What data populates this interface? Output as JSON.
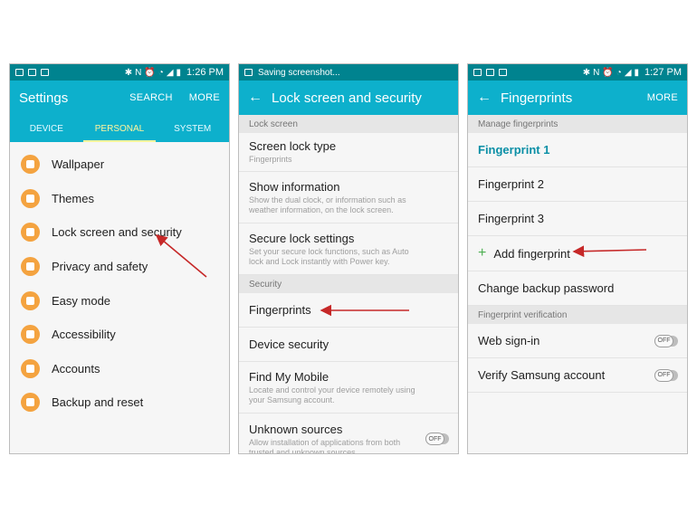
{
  "colors": {
    "status_bar": "#00838f",
    "app_bar": "#0db0cc",
    "icon_bg": "#f4a340",
    "accent": "#0a8fa6",
    "arrow": "#c62828",
    "tab_active": "#fff59d"
  },
  "screen1": {
    "time": "1:26 PM",
    "title": "Settings",
    "actions": [
      "SEARCH",
      "MORE"
    ],
    "tabs": [
      "DEVICE",
      "PERSONAL",
      "SYSTEM"
    ],
    "active_tab": "PERSONAL",
    "items": [
      {
        "label": "Wallpaper",
        "icon": "wallpaper-icon"
      },
      {
        "label": "Themes",
        "icon": "themes-icon"
      },
      {
        "label": "Lock screen and security",
        "icon": "lock-icon"
      },
      {
        "label": "Privacy and safety",
        "icon": "privacy-icon"
      },
      {
        "label": "Easy mode",
        "icon": "home-icon"
      },
      {
        "label": "Accessibility",
        "icon": "hand-icon"
      },
      {
        "label": "Accounts",
        "icon": "key-icon"
      },
      {
        "label": "Backup and reset",
        "icon": "backup-icon"
      }
    ]
  },
  "screen2": {
    "status_text": "Saving screenshot...",
    "title": "Lock screen and security",
    "section_lock": "Lock screen",
    "screen_lock_type": {
      "title": "Screen lock type",
      "sub": "Fingerprints"
    },
    "show_information": {
      "title": "Show information",
      "sub": "Show the dual clock, or information such as weather information, on the lock screen."
    },
    "secure_lock": {
      "title": "Secure lock settings",
      "sub": "Set your secure lock functions, such as Auto lock and Lock instantly with Power key."
    },
    "section_security": "Security",
    "fingerprints": "Fingerprints",
    "device_security": "Device security",
    "find_my_mobile": {
      "title": "Find My Mobile",
      "sub": "Locate and control your device remotely using your Samsung account."
    },
    "unknown_sources": {
      "title": "Unknown sources",
      "sub": "Allow installation of applications from both trusted and unknown sources.",
      "toggle": "OFF"
    }
  },
  "screen3": {
    "time": "1:27 PM",
    "title": "Fingerprints",
    "action": "MORE",
    "section_manage": "Manage fingerprints",
    "fp1": "Fingerprint 1",
    "fp2": "Fingerprint 2",
    "fp3": "Fingerprint 3",
    "add": "Add fingerprint",
    "change_backup": "Change backup password",
    "section_verify": "Fingerprint verification",
    "web_signin": {
      "title": "Web sign-in",
      "toggle": "OFF"
    },
    "verify_samsung": {
      "title": "Verify Samsung account",
      "toggle": "OFF"
    }
  }
}
